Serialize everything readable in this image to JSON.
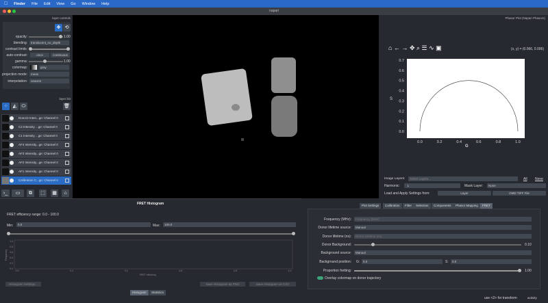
{
  "menu": [
    "Finder",
    "File",
    "Edit",
    "View",
    "Go",
    "Window",
    "Help"
  ],
  "window_title": "napari",
  "layer_controls": {
    "title": "layer controls",
    "opacity_label": "opacity:",
    "opacity_value": "1.00",
    "blending_label": "blending:",
    "blending_value": "translucent_no_depth",
    "contrast_label": "contrast limits:",
    "auto_contrast_label": "auto-contrast:",
    "once": "once",
    "continuous": "continuous",
    "gamma_label": "gamma:",
    "gamma_value": "1.00",
    "colormap_label": "colormap:",
    "colormap_value": "gray",
    "projection_label": "projection mode:",
    "projection_value": "mean",
    "interpolation_label": "interpolation:",
    "interpolation_value": "nearest"
  },
  "layer_list": {
    "title": "layer list",
    "layers": [
      "Donor2 Inten...ge: Channel 0",
      "C2 Intensity ...ge: Channel 0",
      "C1 Intensity ...ge: Channel 0",
      "AF4 Intensity...ge: Channel 0",
      "AF3 Intensity...ge: Channel 0",
      "AF2 Intensity...ge: Channel 0",
      "AF1 Intensity...ge: Channel 0",
      "Calibration C...ge: Channel 0"
    ]
  },
  "phasor": {
    "title": "Phasor Plot (Napari Phasors)",
    "coords": "(x, y) = (0.066, 0.006)",
    "ylabel": "S",
    "xlabel": "G",
    "image_layers_label": "Image Layers:",
    "image_layers_placeholder": "Select Layers...",
    "all": "All",
    "none": "None",
    "harmonic_label": "Harmonic:",
    "harmonic_value": "1",
    "mask_label": "Mask Layer:",
    "mask_value": "None",
    "load_label": "Load and Apply Settings from:",
    "layer_btn": "Layer",
    "ome_btn": "OME-TIFF File",
    "tabs": [
      "Plot Settings",
      "Calibration",
      "Filter",
      "Selection",
      "Components",
      "Phasor Mapping",
      "FRET"
    ]
  },
  "fret_hist": {
    "title": "FRET Histogram",
    "range": "FRET efficiency range: 0.0 - 100.0",
    "min_label": "Min:",
    "min_value": "0.0",
    "max_label": "Max:",
    "max_value": "100.0",
    "xlabel": "FRET efficiency",
    "ylabel": "Frequency",
    "settings_btn": "Histogram Settings...",
    "save_png": "Save Histogram as PNG",
    "save_csv": "Save Histogram as CSV",
    "tab_hist": "Histogram",
    "tab_stats": "Statistics"
  },
  "fret": {
    "freq_label": "Frequency (MHz):",
    "freq_ph": "Frequency (MHz)",
    "donor_src_label": "Donor lifetime source:",
    "donor_src_value": "Manual",
    "donor_lt_label": "Donor lifetime (ns):",
    "donor_lt_ph": "Donor Lifetime (ns)",
    "donor_bg_label": "Donor Background:",
    "donor_bg_value": "0.10",
    "bg_src_label": "Background source:",
    "bg_src_value": "Manual",
    "bg_pos_label": "Background position:",
    "g_label": "G:",
    "g_value": "0.0",
    "s_label": "S:",
    "s_value": "0.0",
    "prop_label": "Proportion fretting:",
    "prop_value": "1.00",
    "overlay_label": "Overlay colormap on donor trajectory"
  },
  "status": "use <2> for transform",
  "activity": "activity"
}
